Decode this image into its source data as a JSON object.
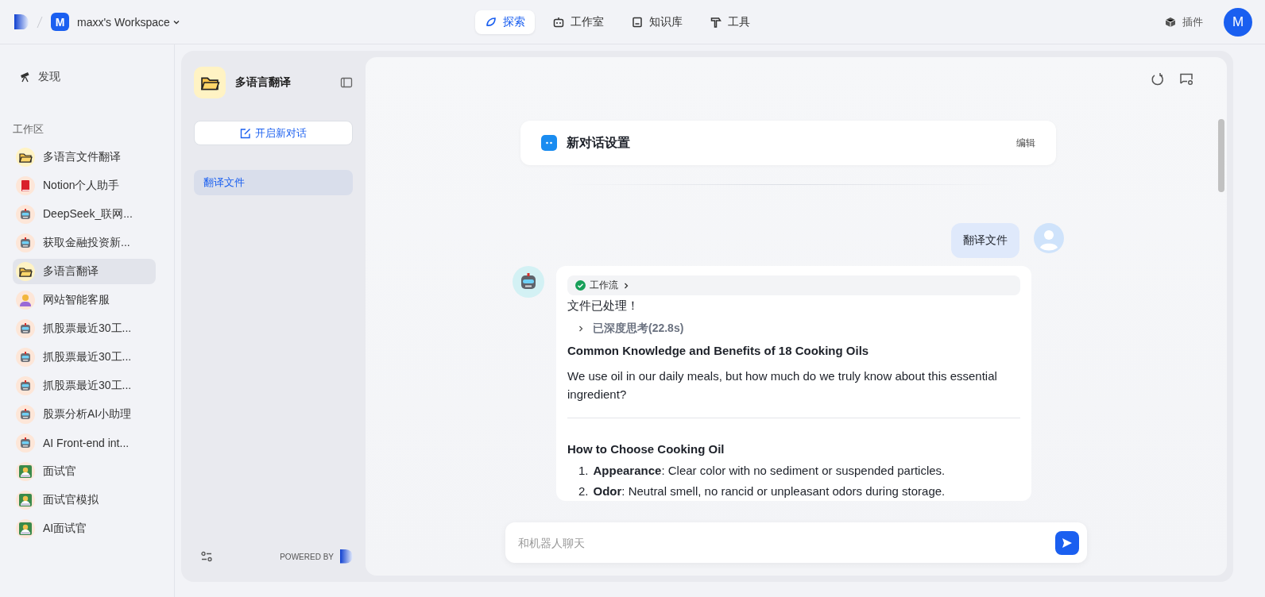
{
  "top_bar": {
    "workspace_initial": "M",
    "workspace_name": "maxx's Workspace",
    "nav_tabs": [
      {
        "label": "探索",
        "kind": "compass",
        "selected": true
      },
      {
        "label": "工作室",
        "kind": "robot",
        "selected": false
      },
      {
        "label": "知识库",
        "kind": "book",
        "selected": false
      },
      {
        "label": "工具",
        "kind": "hammer",
        "selected": false
      }
    ],
    "plugins_label": "插件",
    "user_initial": "M"
  },
  "sidebar": {
    "discover_label": "发现",
    "section_title": "工作区",
    "items": [
      {
        "label": "多语言文件翻译",
        "kind": "folder",
        "selected": false
      },
      {
        "label": "Notion个人助手",
        "kind": "book",
        "selected": false
      },
      {
        "label": "DeepSeek_联网...",
        "kind": "robot",
        "selected": false
      },
      {
        "label": "获取金融投资新...",
        "kind": "robot",
        "selected": false
      },
      {
        "label": "多语言翻译",
        "kind": "folder",
        "selected": true
      },
      {
        "label": "网站智能客服",
        "kind": "person",
        "selected": false
      },
      {
        "label": "抓股票最近30工...",
        "kind": "robot",
        "selected": false
      },
      {
        "label": "抓股票最近30工...",
        "kind": "robot",
        "selected": false
      },
      {
        "label": "抓股票最近30工...",
        "kind": "robot",
        "selected": false
      },
      {
        "label": "股票分析AI小助理",
        "kind": "robot",
        "selected": false
      },
      {
        "label": "AI Front-end int...",
        "kind": "robot",
        "selected": false
      },
      {
        "label": "面试官",
        "kind": "technologist",
        "selected": false
      },
      {
        "label": "面试官模拟",
        "kind": "technologist",
        "selected": false
      },
      {
        "label": "AI面试官",
        "kind": "technologist",
        "selected": false
      }
    ]
  },
  "agent_panel": {
    "title": "多语言翻译",
    "new_chat_button": "开启新对话",
    "conversations": [
      {
        "label": "翻译文件",
        "selected": true
      }
    ],
    "powered_by": "POWERED BY"
  },
  "chat": {
    "settings_card": {
      "title": "新对话设置",
      "edit_link": "编辑"
    },
    "user_message": "翻译文件",
    "reply": {
      "workflow_label": "工作流",
      "status_line": "文件已处理！",
      "thinking_label": "已深度思考(22.8s)",
      "heading": "Common Knowledge and Benefits of 18 Cooking Oils",
      "intro": "We use oil in our daily meals, but how much do we truly know about this essential ingredient?",
      "section_heading": "How to Choose Cooking Oil",
      "list": [
        {
          "number": "1.",
          "text": "**Appearance**: Clear color with no sediment or suspended particles."
        },
        {
          "number": "2.",
          "text": "**Odor**: Neutral smell, no rancid or unpleasant odors during storage."
        }
      ]
    },
    "input": {
      "placeholder": "和机器人聊天"
    }
  }
}
